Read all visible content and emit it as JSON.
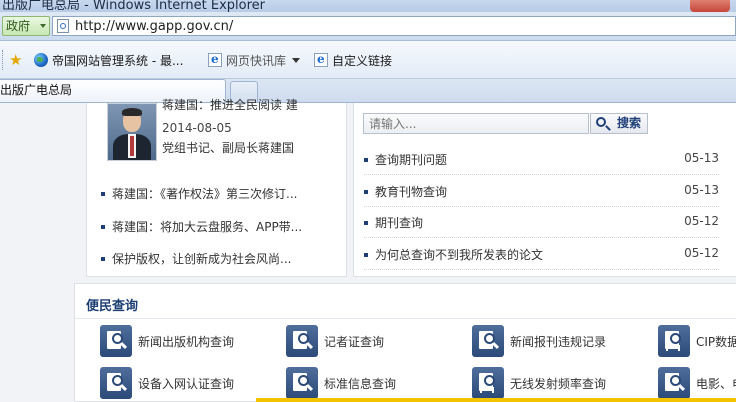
{
  "window": {
    "title": "出版广电总局 - Windows Internet Explorer"
  },
  "address_bar": {
    "security_zone": "政府",
    "url": "http://www.gapp.gov.cn/"
  },
  "favorites_bar": {
    "items": [
      {
        "label": "帝国网站管理系统 - 最...",
        "icon": "globe-icon"
      },
      {
        "label": "网页快讯库",
        "icon": "ie-page-icon",
        "has_dropdown": true
      },
      {
        "label": "自定义链接",
        "icon": "ie-page-icon"
      }
    ]
  },
  "tabs": {
    "active_label": "出版广电总局"
  },
  "leader": {
    "headline": "蒋建国：推进全民阅读 建",
    "date": "2014-08-05",
    "title": "党组书记、副局长蒋建国"
  },
  "news": [
    {
      "text": "蒋建国：《著作权法》第三次修订..."
    },
    {
      "text": "蒋建国：将加大云盘服务、APP带..."
    },
    {
      "text": "保护版权，让创新成为社会风尚..."
    }
  ],
  "search": {
    "placeholder": "请输入...",
    "button_label": "搜索"
  },
  "queries": [
    {
      "text": "查询期刊问题",
      "date": "05-13"
    },
    {
      "text": "教育刊物查询",
      "date": "05-13"
    },
    {
      "text": "期刊查询",
      "date": "05-12"
    },
    {
      "text": "为何总查询不到我所发表的论文",
      "date": "05-12"
    }
  ],
  "services": {
    "heading": "便民查询",
    "items": [
      {
        "label": "新闻出版机构查询",
        "icon": "agency-search-icon"
      },
      {
        "label": "记者证查询",
        "icon": "press-card-search-icon"
      },
      {
        "label": "新闻报刊违规记录",
        "icon": "violation-record-icon"
      },
      {
        "label": "CIP数据",
        "icon": "cip-data-icon"
      },
      {
        "label": "设备入网认证查询",
        "icon": "device-certification-icon"
      },
      {
        "label": "标准信息查询",
        "icon": "standard-info-icon"
      },
      {
        "label": "无线发射频率查询",
        "icon": "wireless-frequency-icon"
      },
      {
        "label": "电影、电",
        "icon": "film-search-icon"
      }
    ]
  },
  "colors": {
    "heading_blue": "#1e3f74",
    "service_icon_blue": "#2c4a78",
    "accent_yellow": "#f3c300"
  }
}
